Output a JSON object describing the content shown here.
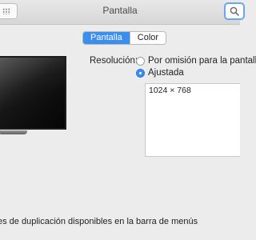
{
  "window": {
    "title": "Pantalla"
  },
  "tabs": [
    {
      "label": "Pantalla",
      "active": true
    },
    {
      "label": "Color",
      "active": false
    }
  ],
  "resolution": {
    "label": "Resolución:",
    "options": [
      {
        "label": "Por omisión para la pantalla",
        "selected": false
      },
      {
        "label": "Ajustada",
        "selected": true
      }
    ],
    "list": [
      "1024 × 768"
    ]
  },
  "footer": {
    "mirroring_text": "es de duplicación disponibles en la barra de menús"
  },
  "colors": {
    "accent": "#3b8eee",
    "background": "#ececec"
  }
}
